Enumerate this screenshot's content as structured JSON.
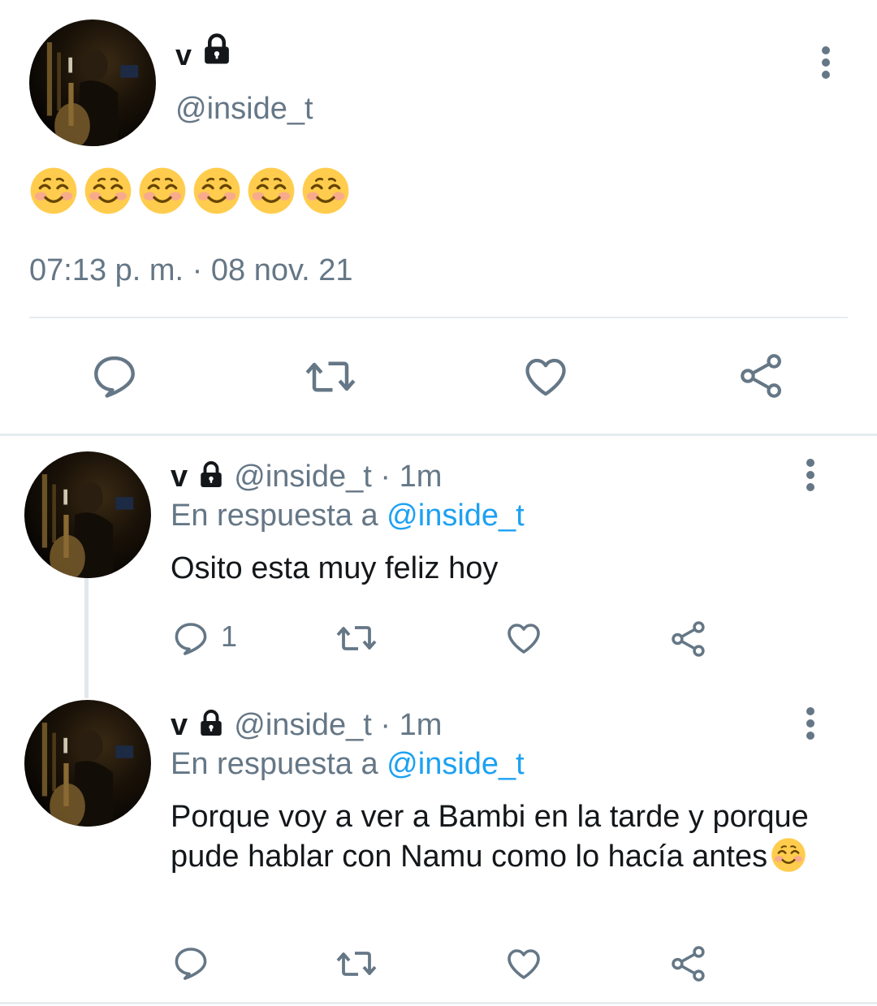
{
  "main_tweet": {
    "display_name": "v",
    "handle": "@inside_t",
    "content_emoji_count": 6,
    "timestamp": "07:13 p. m. · 08 nov. 21",
    "icons": [
      "lock-icon",
      "more-icon",
      "reply-icon",
      "retweet-icon",
      "like-icon",
      "share-icon"
    ]
  },
  "replies": [
    {
      "display_name": "v",
      "handle": "@inside_t",
      "time": "· 1m",
      "reply_prefix": "En respuesta a",
      "reply_to": "@inside_t",
      "text": "Osito esta muy feliz hoy",
      "reply_count": "1"
    },
    {
      "display_name": "v",
      "handle": "@inside_t",
      "time": "· 1m",
      "reply_prefix": "En respuesta a",
      "reply_to": "@inside_t",
      "text": "Porque voy a ver a Bambi en la tarde y porque pude hablar con Namu como lo hacía antes",
      "reply_count": ""
    }
  ],
  "colors": {
    "text": "#14171a",
    "muted": "#657786",
    "link": "#1da1f2",
    "divider": "#e6ecf0",
    "emoji": "#ffcc4d"
  }
}
